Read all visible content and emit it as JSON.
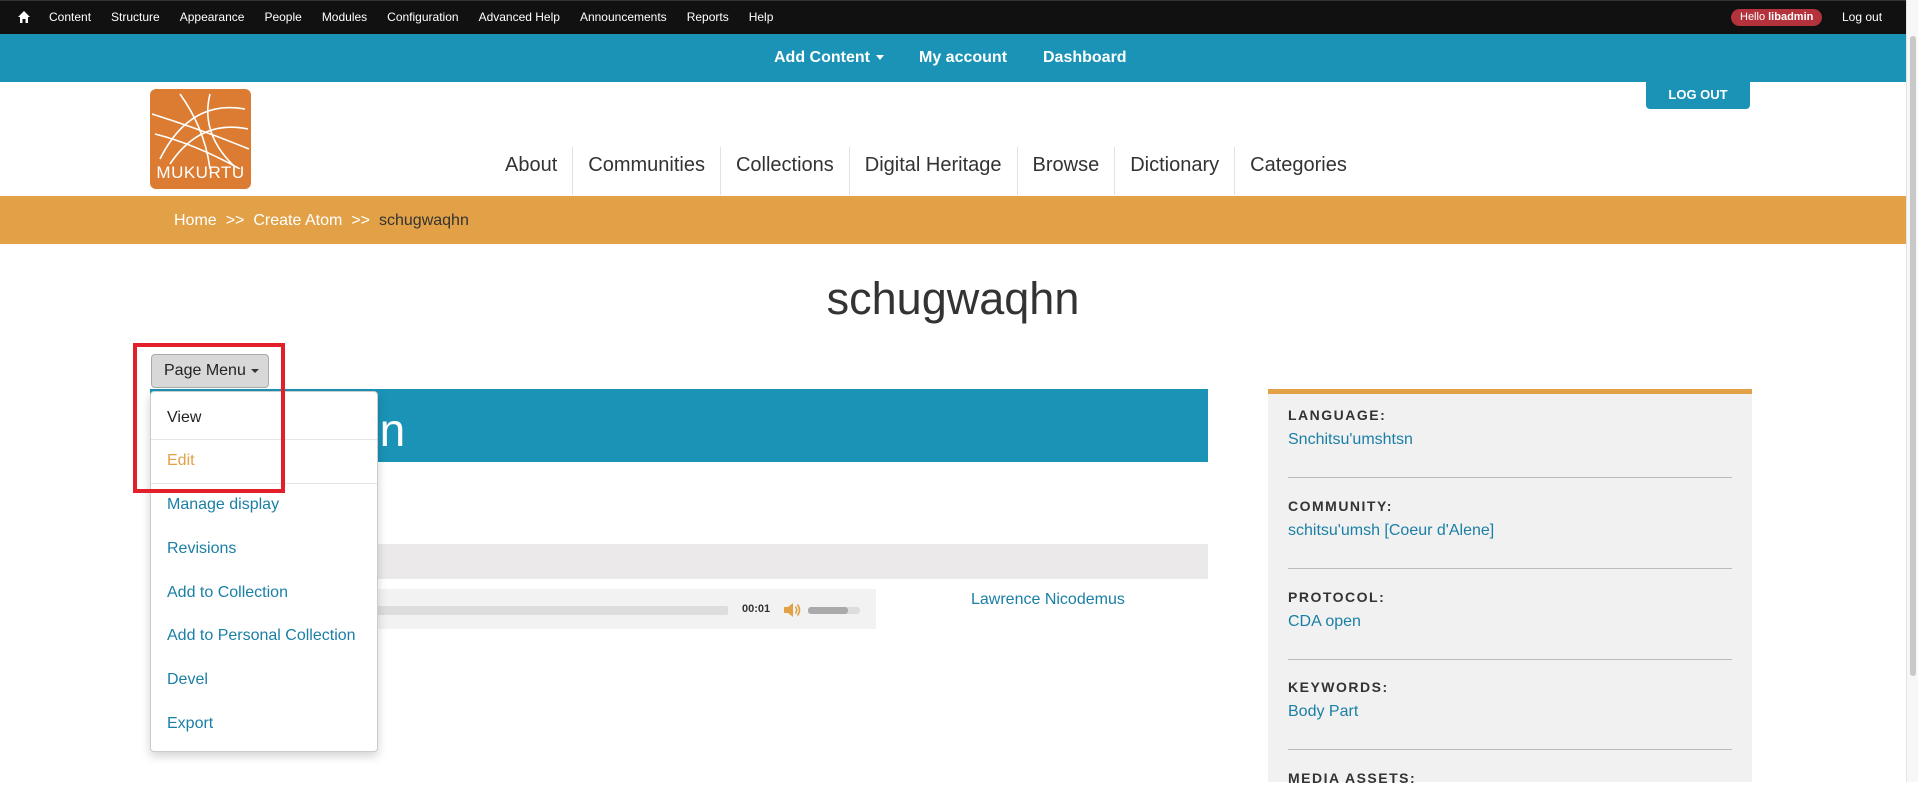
{
  "admin_bar": {
    "home_icon": "home-icon",
    "items": [
      "Content",
      "Structure",
      "Appearance",
      "People",
      "Modules",
      "Configuration",
      "Advanced Help",
      "Announcements",
      "Reports",
      "Help"
    ],
    "hello_prefix": "Hello ",
    "username": "libadmin",
    "logout": "Log out"
  },
  "blue_nav": {
    "add_content": "Add Content",
    "my_account": "My account",
    "dashboard": "Dashboard"
  },
  "header": {
    "logo_text": "MUKURTU",
    "log_out_button": "LOG OUT",
    "nav": [
      "About",
      "Communities",
      "Collections",
      "Digital Heritage",
      "Browse",
      "Dictionary",
      "Categories"
    ]
  },
  "breadcrumb": {
    "home": "Home",
    "separator": ">>",
    "create_atom": "Create Atom",
    "current": "schugwaqhn"
  },
  "page_title": "schugwaqhn",
  "content": {
    "title_partial": "nn",
    "audio_time": "00:01",
    "volume_level": 0.77,
    "contributor": "Lawrence Nicodemus"
  },
  "page_menu": {
    "button_label": "Page Menu",
    "items": [
      "View",
      "Edit",
      "Manage display",
      "Revisions",
      "Add to Collection",
      "Add to Personal Collection",
      "Devel",
      "Export"
    ]
  },
  "sidebar": {
    "fields": [
      {
        "label": "LANGUAGE:",
        "value": "Snchitsu'umshtsn"
      },
      {
        "label": "COMMUNITY:",
        "value": "schitsu'umsh [Coeur d'Alene]"
      },
      {
        "label": "PROTOCOL:",
        "value": "CDA open"
      },
      {
        "label": "KEYWORDS:",
        "value": "Body Part"
      },
      {
        "label": "MEDIA ASSETS:",
        "value": ""
      }
    ]
  },
  "colors": {
    "admin_bar": "#111111",
    "brand_blue": "#1a93b7",
    "brand_orange": "#e2a146",
    "logo_orange": "#db7c32",
    "link": "#1a7fa5",
    "highlight": "#e3202a"
  }
}
